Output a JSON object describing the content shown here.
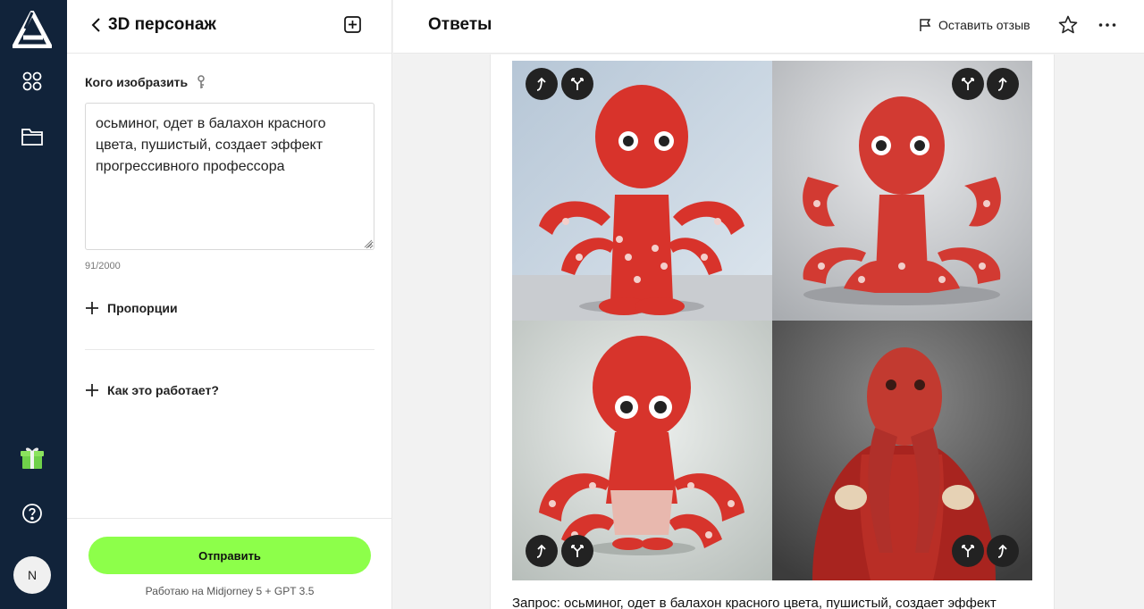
{
  "sidebar": {
    "avatar_initial": "N"
  },
  "panel": {
    "title": "3D персонаж",
    "field_label": "Кого изобразить",
    "prompt_value": "осьминог, одет в балахон красного цвета, пушистый, создает эффект прогрессивного профессора",
    "counter": "91/2000",
    "proportions_label": "Пропорции",
    "how_it_works_label": "Как это работает?",
    "send_label": "Отправить",
    "powered_by": "Работаю на Midjorney 5 + GPT 3.5"
  },
  "main": {
    "title": "Ответы",
    "feedback_label": "Оставить отзыв",
    "caption": "Запрос: осьминог, одет в балахон красного цвета, пушистый, создает эффект"
  },
  "colors": {
    "rail_bg": "#11233a",
    "send_button": "#8dff4a",
    "octopus_red": "#d8332b"
  }
}
